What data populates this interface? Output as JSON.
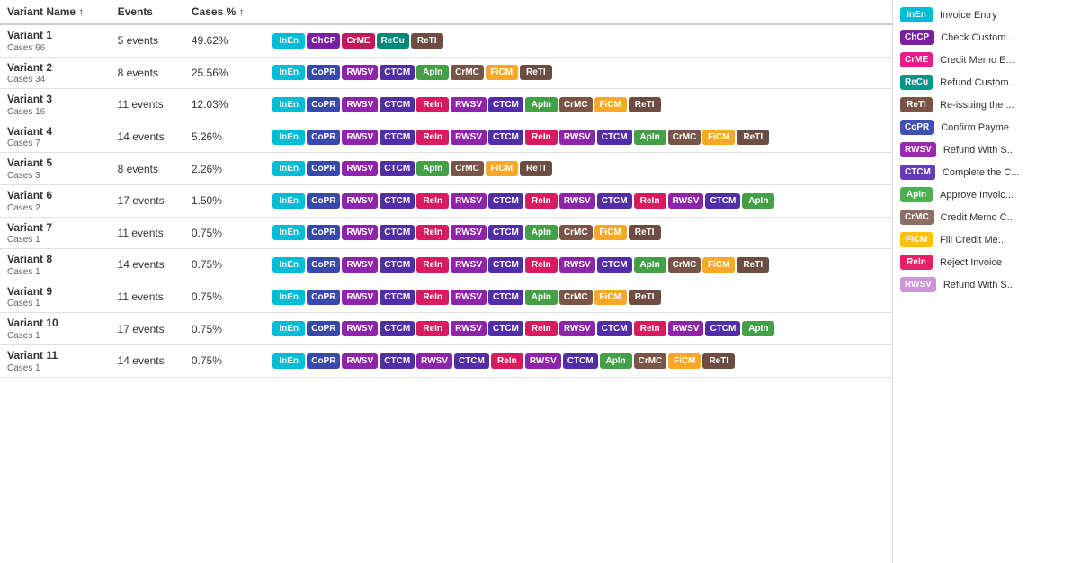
{
  "colors": {
    "InEn": "#00BCD4",
    "ChCP": "#7B1FA2",
    "CrME": "#E91E8C",
    "ReCu": "#009688",
    "ReTI": "#795548",
    "CoPR": "#3F51B5",
    "RWSV": "#9C27B0",
    "CTCM": "#673AB7",
    "ApIn": "#4CAF50",
    "CrMC": "#8D6E63",
    "FiCM": "#FFC107",
    "ReIn": "#E91E63",
    "RWSV2": "#CE93D8"
  },
  "headers": {
    "variant_name": "Variant Name ↑",
    "events": "Events",
    "cases_pct": "Cases % ↑"
  },
  "variants": [
    {
      "name": "Variant 1",
      "cases": "Cases 66",
      "events": "5 events",
      "pct": "49.62%",
      "steps": [
        "InEn",
        "ChCP",
        "CrME",
        "ReCu",
        "ReTI"
      ]
    },
    {
      "name": "Variant 2",
      "cases": "Cases 34",
      "events": "8 events",
      "pct": "25.56%",
      "steps": [
        "InEn",
        "CoPR",
        "RWSV",
        "CTCM",
        "ApIn",
        "CrMC",
        "FiCM",
        "ReTI"
      ]
    },
    {
      "name": "Variant 3",
      "cases": "Cases 16",
      "events": "11 events",
      "pct": "12.03%",
      "steps": [
        "InEn",
        "CoPR",
        "RWSV",
        "CTCM",
        "ReIn",
        "RWSV",
        "CTCM",
        "ApIn",
        "CrMC",
        "FiCM",
        "ReTI"
      ]
    },
    {
      "name": "Variant 4",
      "cases": "Cases 7",
      "events": "14 events",
      "pct": "5.26%",
      "steps": [
        "InEn",
        "CoPR",
        "RWSV",
        "CTCM",
        "ReIn",
        "RWSV",
        "CTCM",
        "ReIn",
        "RWSV",
        "CTCM",
        "ApIn",
        "CrMC",
        "FiCM",
        "ReTI"
      ]
    },
    {
      "name": "Variant 5",
      "cases": "Cases 3",
      "events": "8 events",
      "pct": "2.26%",
      "steps": [
        "InEn",
        "CoPR",
        "RWSV",
        "CTCM",
        "ApIn",
        "CrMC",
        "FiCM",
        "ReTI"
      ]
    },
    {
      "name": "Variant 6",
      "cases": "Cases 2",
      "events": "17 events",
      "pct": "1.50%",
      "steps": [
        "InEn",
        "CoPR",
        "RWSV",
        "CTCM",
        "ReIn",
        "RWSV",
        "CTCM",
        "ReIn",
        "RWSV",
        "CTCM",
        "ReIn",
        "RWSV",
        "CTCM",
        "ApIn"
      ]
    },
    {
      "name": "Variant 7",
      "cases": "Cases 1",
      "events": "11 events",
      "pct": "0.75%",
      "steps": [
        "InEn",
        "CoPR",
        "RWSV",
        "CTCM",
        "ReIn",
        "RWSV",
        "CTCM",
        "ApIn",
        "CrMC",
        "FiCM",
        "ReTI"
      ]
    },
    {
      "name": "Variant 8",
      "cases": "Cases 1",
      "events": "14 events",
      "pct": "0.75%",
      "steps": [
        "InEn",
        "CoPR",
        "RWSV",
        "CTCM",
        "ReIn",
        "RWSV",
        "CTCM",
        "ReIn",
        "RWSV",
        "CTCM",
        "ApIn",
        "CrMC",
        "FiCM",
        "ReTI"
      ]
    },
    {
      "name": "Variant 9",
      "cases": "Cases 1",
      "events": "11 events",
      "pct": "0.75%",
      "steps": [
        "InEn",
        "CoPR",
        "RWSV",
        "CTCM",
        "ReIn",
        "RWSV",
        "CTCM",
        "ApIn",
        "CrMC",
        "FiCM",
        "ReTI"
      ]
    },
    {
      "name": "Variant 10",
      "cases": "Cases 1",
      "events": "17 events",
      "pct": "0.75%",
      "steps": [
        "InEn",
        "CoPR",
        "RWSV",
        "CTCM",
        "ReIn",
        "RWSV",
        "CTCM",
        "ReIn",
        "RWSV",
        "CTCM",
        "ReIn",
        "RWSV",
        "CTCM",
        "ApIn"
      ]
    },
    {
      "name": "Variant 11",
      "cases": "Cases 1",
      "events": "14 events",
      "pct": "0.75%",
      "steps": [
        "InEn",
        "CoPR",
        "RWSV",
        "CTCM",
        "RWSV",
        "CTCM",
        "ReIn",
        "RWSV",
        "CTCM",
        "ApIn",
        "CrMC",
        "FiCM",
        "ReTI"
      ]
    }
  ],
  "legend": [
    {
      "code": "InEn",
      "label": "Invoice Entry",
      "color": "#00BCD4"
    },
    {
      "code": "ChCP",
      "label": "Check Custom...",
      "color": "#7B1FA2"
    },
    {
      "code": "CrME",
      "label": "Credit Memo E...",
      "color": "#E91E8C"
    },
    {
      "code": "ReCu",
      "label": "Refund Custom...",
      "color": "#009688"
    },
    {
      "code": "ReTI",
      "label": "Re-issuing the ...",
      "color": "#795548"
    },
    {
      "code": "CoPR",
      "label": "Confirm Payme...",
      "color": "#3F51B5"
    },
    {
      "code": "RWSV",
      "label": "Refund With S...",
      "color": "#9C27B0"
    },
    {
      "code": "CTCM",
      "label": "Complete the C...",
      "color": "#673AB7"
    },
    {
      "code": "ApIn",
      "label": "Approve Invoic...",
      "color": "#4CAF50"
    },
    {
      "code": "CrMC",
      "label": "Credit Memo C...",
      "color": "#8D6E63"
    },
    {
      "code": "FiCM",
      "label": "Fill Credit Me...",
      "color": "#FFC107"
    },
    {
      "code": "ReIn",
      "label": "Reject Invoice",
      "color": "#E91E63"
    },
    {
      "code": "RWSV",
      "label": "Refund With S...",
      "color": "#CE93D8"
    }
  ],
  "step_colors": {
    "InEn": "#00BCD4",
    "ChCP": "#7B1FA2",
    "CrME": "#E91E8C",
    "ReCu": "#009688",
    "ReTI": "#795548",
    "CoPR": "#3F51B5",
    "RWSV": "#9C27B0",
    "CTCM": "#673AB7",
    "ApIn": "#4CAF50",
    "CrMC": "#8D6E63",
    "FiCM": "#FFC107",
    "ReIn": "#E91E63"
  }
}
